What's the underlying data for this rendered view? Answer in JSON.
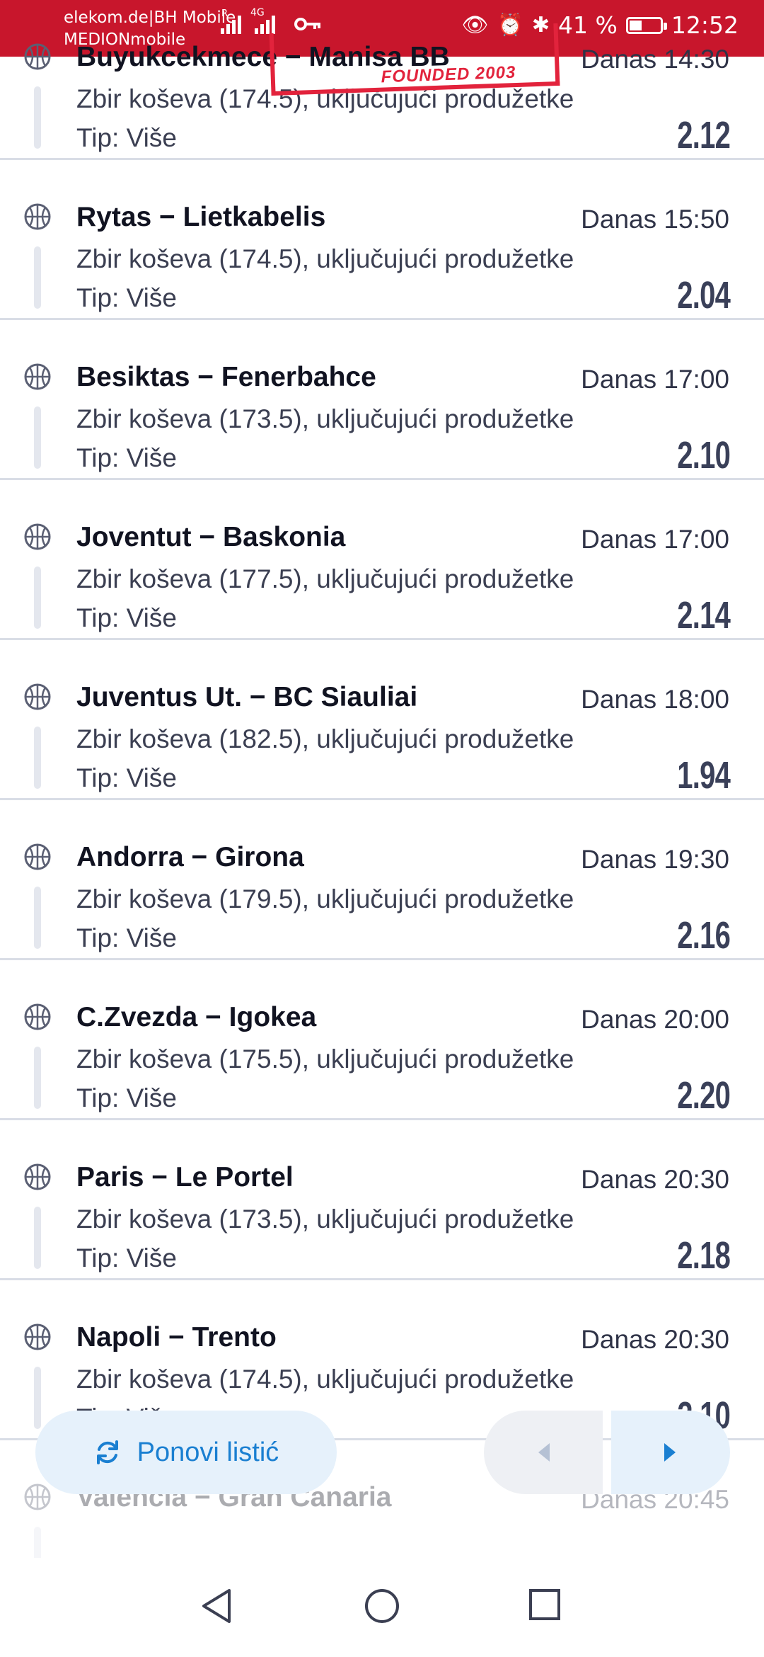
{
  "status_bar": {
    "carrier_line1": "elekom.de|BH Mobile",
    "carrier_line2": "MEDIONmobile",
    "network_type": "4G",
    "roaming_indicator": "R",
    "battery": "41 %",
    "battery_level": 0.41,
    "time": "12:52"
  },
  "stamp": {
    "text": "FOUNDED 2003"
  },
  "bets": [
    {
      "match": "Buyukcekmece − Manisa BB",
      "time": "Danas 14:30",
      "market": "Zbir koševa (174.5), uključujući produžetke",
      "tip": "Tip: Više",
      "odd": "2.12"
    },
    {
      "match": "Rytas − Lietkabelis",
      "time": "Danas 15:50",
      "market": "Zbir koševa (174.5), uključujući produžetke",
      "tip": "Tip: Više",
      "odd": "2.04"
    },
    {
      "match": "Besiktas − Fenerbahce",
      "time": "Danas 17:00",
      "market": "Zbir koševa (173.5), uključujući produžetke",
      "tip": "Tip: Više",
      "odd": "2.10"
    },
    {
      "match": "Joventut − Baskonia",
      "time": "Danas 17:00",
      "market": "Zbir koševa (177.5), uključujući produžetke",
      "tip": "Tip: Više",
      "odd": "2.14"
    },
    {
      "match": "Juventus Ut. − BC Siauliai",
      "time": "Danas 18:00",
      "market": "Zbir koševa (182.5), uključujući produžetke",
      "tip": "Tip: Više",
      "odd": "1.94"
    },
    {
      "match": "Andorra − Girona",
      "time": "Danas 19:30",
      "market": "Zbir koševa (179.5), uključujući produžetke",
      "tip": "Tip: Više",
      "odd": "2.16"
    },
    {
      "match": "C.Zvezda − Igokea",
      "time": "Danas 20:00",
      "market": "Zbir koševa (175.5), uključujući produžetke",
      "tip": "Tip: Više",
      "odd": "2.20"
    },
    {
      "match": "Paris − Le Portel",
      "time": "Danas 20:30",
      "market": "Zbir koševa (173.5), uključujući produžetke",
      "tip": "Tip: Više",
      "odd": "2.18"
    },
    {
      "match": "Napoli − Trento",
      "time": "Danas 20:30",
      "market": "Zbir koševa (174.5), uključujući produžetke",
      "tip": "Tip: Više",
      "odd": "2.10"
    },
    {
      "match": "Valencia − Gran Canaria",
      "time": "Danas 20:45",
      "market": "",
      "tip": "",
      "odd": ""
    }
  ],
  "actions": {
    "repeat_label": "Ponovi listić",
    "repeat_icon": "refresh-icon",
    "prev_icon": "caret-left-icon",
    "next_icon": "caret-right-icon"
  },
  "colors": {
    "status_bar": "#c8162c",
    "accent_blue": "#1a7fd1",
    "odd_text": "#3a4059"
  }
}
